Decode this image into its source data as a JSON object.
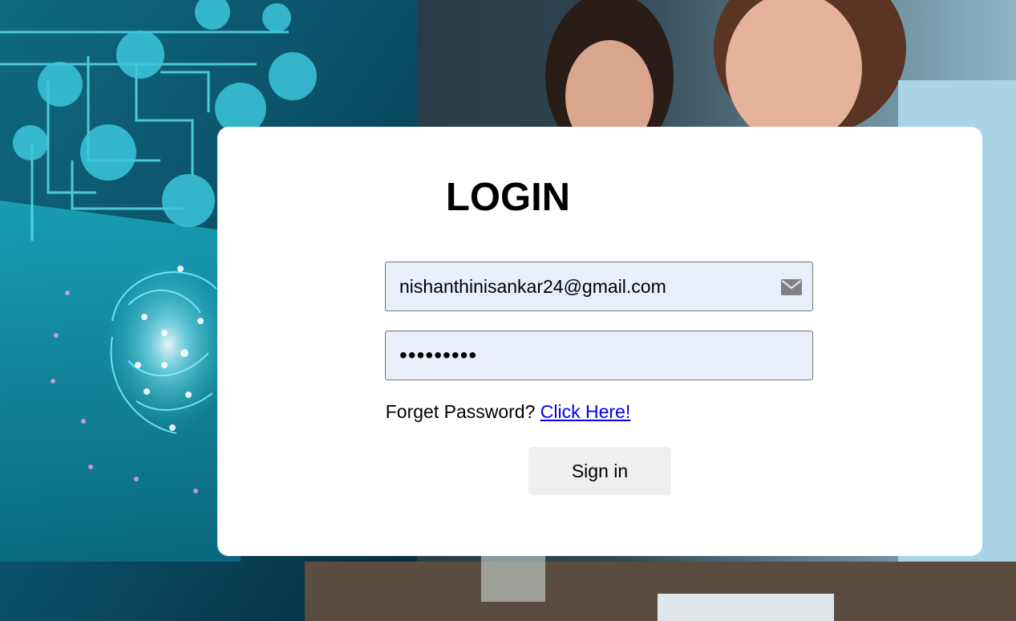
{
  "page": {
    "title": "LOGIN"
  },
  "login": {
    "email_value": "nishanthinisankar24@gmail.com",
    "email_icon": "envelope-icon",
    "password_mask": "•••••••••",
    "forgot_text": "Forget Password?",
    "forgot_link": "Click Here!",
    "signin_label": "Sign in"
  },
  "colors": {
    "card": "#ffffff",
    "input_bg": "#e8effb",
    "link": "#0000ee",
    "button_bg": "#efefef",
    "background_accent": "#1fb5c9"
  }
}
